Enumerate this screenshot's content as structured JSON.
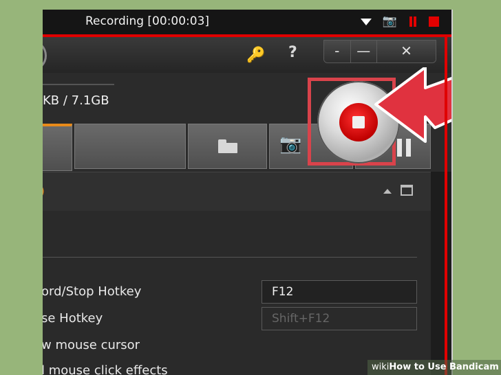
{
  "recording_bar": {
    "title": "Recording [00:00:03]",
    "icons": [
      "dropdown-triangle-icon",
      "camera-icon",
      "pause-icon",
      "stop-icon"
    ]
  },
  "titlebar": {
    "key_icon": "🔑",
    "help_label": "?",
    "window_buttons": [
      "-",
      "—",
      "✕"
    ]
  },
  "status": {
    "size_text": "KB / 7.1GB"
  },
  "toolbar": {
    "camera_glyph": "📷",
    "stop_button": "stop-record-button"
  },
  "panel_header": {
    "title_fragment": ")"
  },
  "settings": {
    "rows": [
      {
        "label": "ord/Stop Hotkey",
        "value": "F12"
      },
      {
        "label": "se Hotkey",
        "value": "Shift+F12"
      },
      {
        "label": "w mouse cursor"
      },
      {
        "label": "l mouse click effects"
      }
    ]
  },
  "watermark": {
    "brand": "wiki",
    "text": "How to Use Bandicam"
  },
  "colors": {
    "background": "#97b57a",
    "record_red": "#e00000",
    "accent_orange": "#e88a1a",
    "highlight_arrow": "#e0323f"
  }
}
